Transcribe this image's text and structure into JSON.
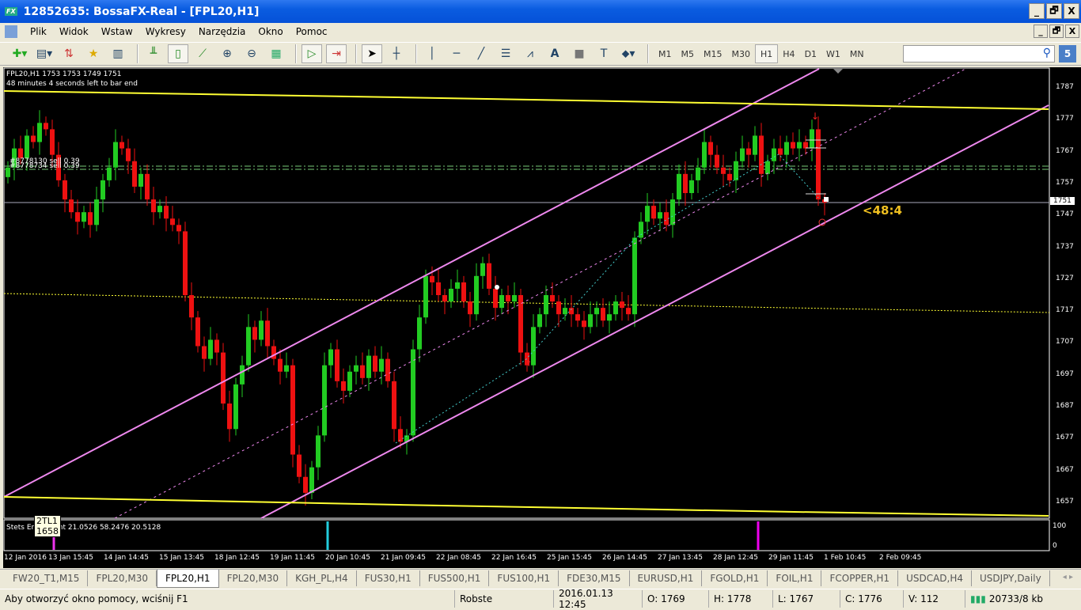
{
  "window": {
    "title": "12852635: BossaFX-Real - [FPL20,H1]",
    "logo": "FX",
    "minimize": "_",
    "restore": "🗗",
    "close": "X"
  },
  "menu": [
    "Plik",
    "Widok",
    "Wstaw",
    "Wykresy",
    "Narzędzia",
    "Okno",
    "Pomoc"
  ],
  "toolbar": {
    "timeframes": [
      "M1",
      "M5",
      "M15",
      "M30",
      "H1",
      "H4",
      "D1",
      "W1",
      "MN"
    ],
    "active_timeframe": "H1",
    "search_value": "",
    "badge": "5"
  },
  "chart": {
    "header": "FPL20,H1  1753 1753 1749 1751",
    "countdown": "48 minutes 4 seconds left to bar end",
    "orders": [
      "#8778130 sell 0.39",
      "#8778734 sell 0.39"
    ],
    "timer_label": "<48:4",
    "current_price": "1751",
    "price_ticks": [
      "1787",
      "1777",
      "1767",
      "1757",
      "1747",
      "1737",
      "1727",
      "1717",
      "1707",
      "1697",
      "1687",
      "1677",
      "1667",
      "1657"
    ],
    "time_ticks": [
      "12 Jan 2016",
      "13 Jan 15:45",
      "14 Jan 14:45",
      "15 Jan 13:45",
      "18 Jan 12:45",
      "19 Jan 11:45",
      "20 Jan 10:45",
      "21 Jan 09:45",
      "22 Jan 08:45",
      "22 Jan 16:45",
      "25 Jan 15:45",
      "26 Jan 14:45",
      "27 Jan 13:45",
      "28 Jan 12:45",
      "29 Jan 11:45",
      "1 Feb 10:45",
      "2 Feb 09:45"
    ],
    "indicator_label": "Stets Entry Point 21.0526 58.2476 20.5128",
    "indicator_ticks": [
      "100",
      "0"
    ],
    "tooltip": [
      "2TL1",
      "1658"
    ],
    "price_range": [
      1657,
      1787
    ],
    "closes": [
      1762,
      1768,
      1765,
      1772,
      1770,
      1776,
      1774,
      1766,
      1758,
      1752,
      1748,
      1745,
      1748,
      1744,
      1752,
      1758,
      1762,
      1770,
      1768,
      1764,
      1756,
      1760,
      1752,
      1748,
      1750,
      1746,
      1744,
      1742,
      1722,
      1715,
      1706,
      1702,
      1708,
      1704,
      1688,
      1680,
      1694,
      1700,
      1712,
      1708,
      1714,
      1706,
      1702,
      1698,
      1700,
      1672,
      1665,
      1660,
      1668,
      1678,
      1700,
      1705,
      1695,
      1692,
      1698,
      1700,
      1696,
      1703,
      1698,
      1702,
      1695,
      1680,
      1676,
      1678,
      1705,
      1715,
      1728,
      1726,
      1722,
      1720,
      1724,
      1726,
      1720,
      1716,
      1728,
      1732,
      1724,
      1718,
      1722,
      1720,
      1722,
      1704,
      1700,
      1712,
      1716,
      1722,
      1720,
      1716,
      1718,
      1716,
      1714,
      1712,
      1716,
      1718,
      1714,
      1716,
      1720,
      1718,
      1716,
      1740,
      1745,
      1750,
      1746,
      1748,
      1744,
      1752,
      1760,
      1754,
      1758,
      1762,
      1770,
      1766,
      1762,
      1760,
      1758,
      1764,
      1768,
      1766,
      1772,
      1760,
      1764,
      1768,
      1766,
      1770,
      1768,
      1770,
      1768,
      1774,
      1752,
      1751
    ],
    "colors": {
      "bull": "#22cc22",
      "bear": "#ee1111",
      "channel": "#ee88ee",
      "support": "#ffff33"
    }
  },
  "tabs": [
    "FW20_T1,M15",
    "FPL20,M30",
    "FPL20,H1",
    "FPL20,M30",
    "KGH_PL,H4",
    "FUS30,H1",
    "FUS500,H1",
    "FUS100,H1",
    "FDE30,M15",
    "EURUSD,H1",
    "FGOLD,H1",
    "FOIL,H1",
    "FCOPPER,H1",
    "USDCAD,H4",
    "USDJPY,Daily"
  ],
  "active_tab": "FPL20,H1",
  "status": {
    "help": "Aby otworzyć okno pomocy, wciśnij F1",
    "profile": "Robste",
    "datetime": "2016.01.13 12:45",
    "open": "O: 1769",
    "high": "H: 1778",
    "low": "L: 1767",
    "close": "C: 1776",
    "volume": "V: 112",
    "traffic": "20733/8 kb"
  }
}
